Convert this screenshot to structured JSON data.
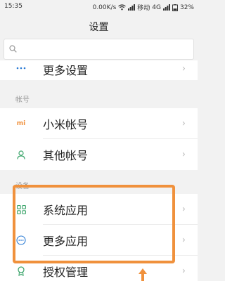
{
  "status": {
    "time": "15:35",
    "speed": "0.00K/s",
    "carrier": "移动",
    "network": "4G",
    "battery": "32%"
  },
  "header": {
    "title": "设置"
  },
  "search": {
    "placeholder": ""
  },
  "rows": {
    "more_settings": "更多设置",
    "mi_account": "小米帐号",
    "other_accounts": "其他帐号",
    "system_apps": "系统应用",
    "more_apps": "更多应用",
    "auth_manage": "授权管理"
  },
  "sections": {
    "accounts": "帐号",
    "device": "设备"
  },
  "icons": {
    "mi_glyph": "mi",
    "chevron": "›"
  },
  "colors": {
    "accent": "#f0913c",
    "icon_orange": "#f0913c",
    "icon_blue": "#2b7bd4",
    "icon_green": "#3aa46a"
  }
}
